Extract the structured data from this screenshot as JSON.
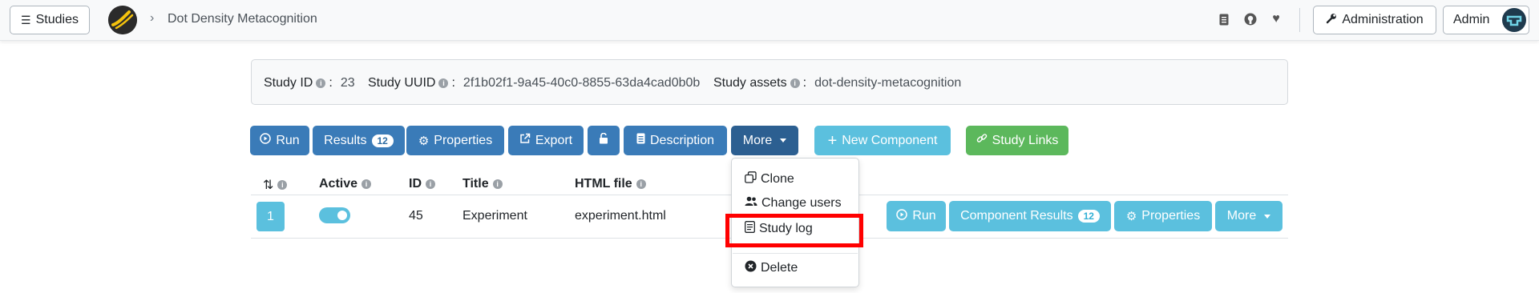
{
  "navbar": {
    "studies_label": "Studies",
    "breadcrumb": "Dot Density Metacognition",
    "admin_button_label": "Administration",
    "user_label": "Admin",
    "icons": [
      "document-icon",
      "github-icon",
      "heart-icon"
    ]
  },
  "info": {
    "study_id_label": "Study ID",
    "study_id": "23",
    "study_uuid_label": "Study UUID",
    "study_uuid": "2f1b02f1-9a45-40c0-8855-63da4cad0b0b",
    "study_assets_label": "Study assets",
    "study_assets": "dot-density-metacognition"
  },
  "toolbar": {
    "run_label": "Run",
    "results_label": "Results",
    "results_count": "12",
    "properties_label": "Properties",
    "export_label": "Export",
    "description_label": "Description",
    "more_label": "More",
    "new_component_label": "New Component",
    "study_links_label": "Study Links"
  },
  "table": {
    "headers": {
      "position": "",
      "active": "Active",
      "id": "ID",
      "title": "Title",
      "html_file": "HTML file"
    },
    "rows": [
      {
        "position": "1",
        "active": true,
        "id": "45",
        "title": "Experiment",
        "html_file": "experiment.html",
        "run_label": "Run",
        "results_label": "Component Results",
        "results_count": "12",
        "properties_label": "Properties",
        "more_label": "More"
      }
    ]
  },
  "dropdown": {
    "items": [
      {
        "label": "Clone",
        "icon": "copy-icon"
      },
      {
        "label": "Change users",
        "icon": "users-icon"
      },
      {
        "label": "Study log",
        "icon": "log-icon"
      },
      {
        "label": "Delete",
        "icon": "delete-icon"
      }
    ],
    "highlighted": "Study log"
  },
  "colors": {
    "primary": "#3a7bb8",
    "primary_active": "#2c5f91",
    "info": "#5bc0de",
    "success": "#5cb85c",
    "highlight": "#ff0000"
  }
}
